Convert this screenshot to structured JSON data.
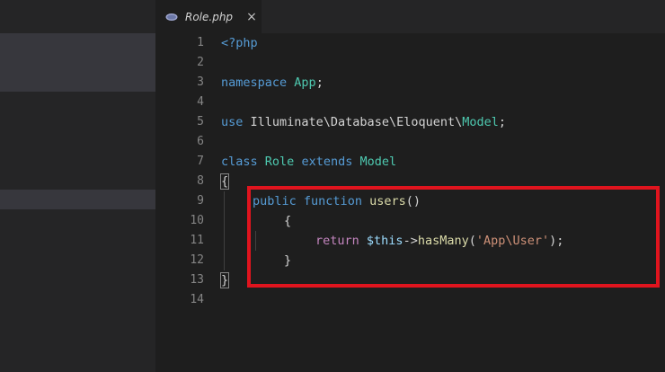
{
  "tab": {
    "filename": "Role.php",
    "close_glyph": "×",
    "icon": "php-file-icon"
  },
  "line_numbers": [
    "1",
    "2",
    "3",
    "4",
    "5",
    "6",
    "7",
    "8",
    "9",
    "10",
    "11",
    "12",
    "13",
    "14"
  ],
  "code": {
    "l1": {
      "open_tag": "<?php"
    },
    "l3": {
      "kw": "namespace",
      "ns": "App",
      "semi": ";"
    },
    "l5": {
      "kw": "use",
      "path": " Illuminate\\Database\\Eloquent\\",
      "cls": "Model",
      "semi": ";"
    },
    "l7": {
      "kw_class": "class",
      "name": "Role",
      "kw_ext": "extends",
      "parent": "Model"
    },
    "l8": {
      "brace": "{"
    },
    "l9": {
      "kw_public": "public",
      "kw_function": "function",
      "fn": "users",
      "parens": "()"
    },
    "l10": {
      "brace": "{"
    },
    "l11": {
      "kw_return": "return",
      "this": "$this",
      "arrow": "->",
      "method": "hasMany",
      "lp": "(",
      "arg": "'App\\User'",
      "rp": ");"
    },
    "l12": {
      "brace": "}"
    },
    "l13": {
      "brace": "}"
    }
  },
  "colors": {
    "highlight_box": "#e0141e",
    "keyword": "#569cd6",
    "type": "#4ec9b0",
    "function": "#dcdcaa",
    "string": "#ce9178"
  }
}
